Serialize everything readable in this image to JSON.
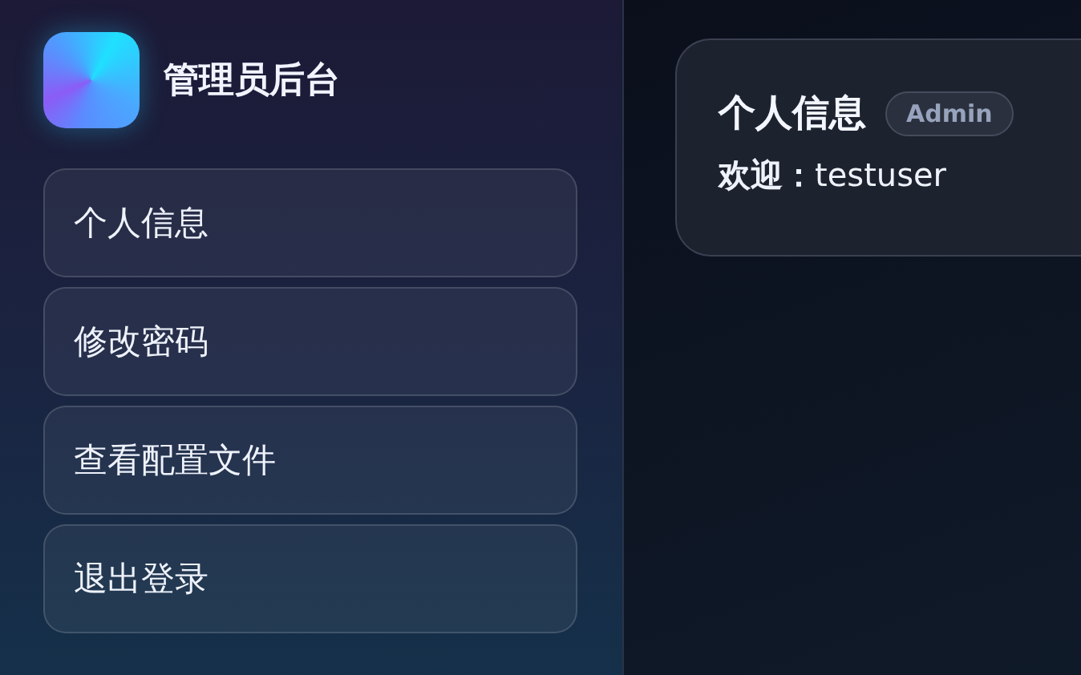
{
  "sidebar": {
    "title": "管理员后台",
    "items": [
      {
        "label": "个人信息"
      },
      {
        "label": "修改密码"
      },
      {
        "label": "查看配置文件"
      },
      {
        "label": "退出登录"
      }
    ]
  },
  "card": {
    "title": "个人信息",
    "badge": "Admin",
    "welcome": "**欢迎：**testuser"
  }
}
